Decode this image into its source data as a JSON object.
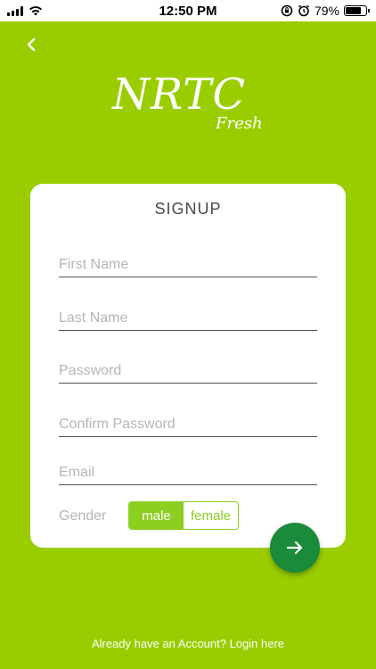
{
  "status_bar": {
    "time": "12:50 PM",
    "battery": "79%",
    "battery_level": 0.79,
    "icons": [
      "signal-icon",
      "wifi-icon",
      "screen-rotation-lock-icon",
      "alarm-icon",
      "battery-icon"
    ]
  },
  "header": {
    "back_icon": "chevron-left-icon",
    "logo_main": "NRTC",
    "logo_sub": "Fresh"
  },
  "form": {
    "title": "SIGNUP",
    "first_name_placeholder": "First Name",
    "last_name_placeholder": "Last Name",
    "password_placeholder": "Password",
    "confirm_password_placeholder": "Confirm Password",
    "email_placeholder": "Email",
    "gender_label": "Gender",
    "gender_options": [
      "male",
      "female"
    ],
    "gender_selected": "male",
    "submit_icon": "arrow-right-icon"
  },
  "footer": {
    "login_link": "Already have an Account? Login here"
  },
  "colors": {
    "background": "#9acd00",
    "segment_accent": "#8ccf21",
    "fab": "#1a8a3b"
  }
}
